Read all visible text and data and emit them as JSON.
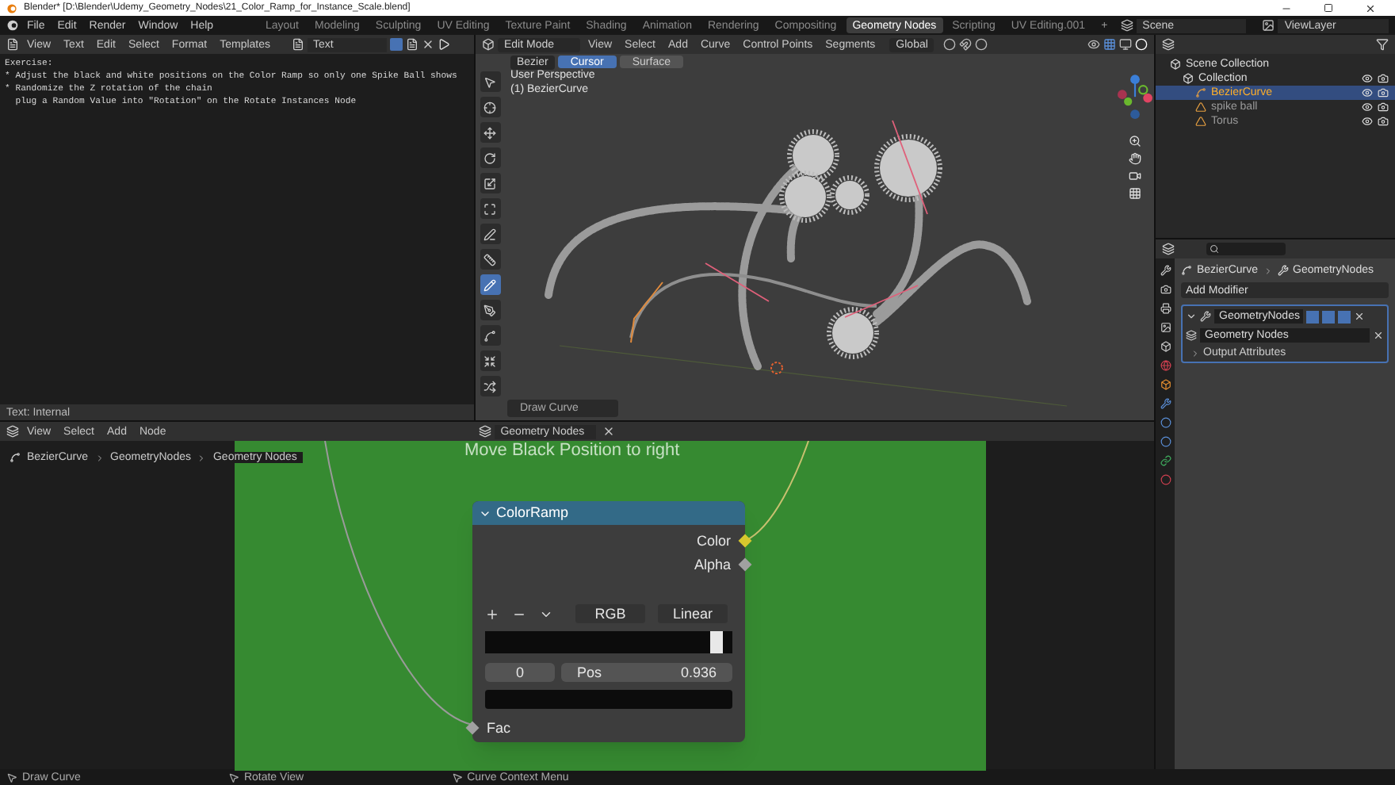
{
  "window": {
    "title": "Blender* [D:\\Blender\\Udemy_Geometry_Nodes\\21_Color_Ramp_for_Instance_Scale.blend]"
  },
  "menu": [
    "File",
    "Edit",
    "Render",
    "Window",
    "Help"
  ],
  "workspaces": [
    {
      "label": "Layout",
      "selected": false
    },
    {
      "label": "Modeling",
      "selected": false
    },
    {
      "label": "Sculpting",
      "selected": false
    },
    {
      "label": "UV Editing",
      "selected": false
    },
    {
      "label": "Texture Paint",
      "selected": false
    },
    {
      "label": "Shading",
      "selected": false
    },
    {
      "label": "Animation",
      "selected": false
    },
    {
      "label": "Rendering",
      "selected": false
    },
    {
      "label": "Compositing",
      "selected": false
    },
    {
      "label": "Geometry Nodes",
      "selected": true
    },
    {
      "label": "Scripting",
      "selected": false
    },
    {
      "label": "UV Editing.001",
      "selected": false
    }
  ],
  "add_workspace": "+",
  "scene": "Scene",
  "view_layer": "ViewLayer",
  "text_editor": {
    "menu": [
      "View",
      "Text",
      "Edit",
      "Select",
      "Format",
      "Templates"
    ],
    "text_name": "Text",
    "lines": [
      "Exercise:",
      "* Adjust the black and white positions on the Color Ramp so only one Spike Ball shows",
      "* Randomize the Z rotation of the chain",
      "  plug a Random Value into \"Rotation\" on the Rotate Instances Node"
    ],
    "footer": "Text: Internal"
  },
  "viewport": {
    "mode": "Edit Mode",
    "menu": [
      "View",
      "Select",
      "Add",
      "Curve",
      "Control Points",
      "Segments"
    ],
    "orientation": "Global",
    "curve_type": "Bezier",
    "draw_modes": [
      {
        "label": "Cursor",
        "selected": true
      },
      {
        "label": "Surface",
        "selected": false
      }
    ],
    "perspective": "User Perspective",
    "object": "(1) BezierCurve",
    "tools": [
      {
        "selected": false
      },
      {
        "selected": false
      },
      {
        "selected": false
      },
      {
        "selected": false
      },
      {
        "selected": false
      },
      {
        "selected": false
      },
      {
        "selected": false
      },
      {
        "selected": false
      },
      {
        "selected": true
      },
      {
        "selected": false
      },
      {
        "selected": false
      },
      {
        "selected": false
      },
      {
        "selected": false
      }
    ],
    "last_operator": "Draw Curve"
  },
  "outliner": {
    "tree": [
      {
        "label": "Scene Collection",
        "kind": "scene",
        "selected": false,
        "children": [
          {
            "label": "Collection",
            "kind": "collection",
            "selected": false,
            "children": [
              {
                "label": "BezierCurve",
                "kind": "curve",
                "selected": true
              },
              {
                "label": "spike ball",
                "kind": "mesh",
                "selected": false
              },
              {
                "label": "Torus",
                "kind": "mesh",
                "selected": false
              }
            ]
          }
        ]
      }
    ]
  },
  "properties": {
    "breadcrumb": [
      "BezierCurve",
      "GeometryNodes"
    ],
    "add_modifier": "Add Modifier",
    "modifier": {
      "name": "GeometryNodes",
      "expanded": true,
      "node_group": "Geometry Nodes",
      "sections": [
        "Output Attributes"
      ]
    }
  },
  "node_editor": {
    "menu": [
      "View",
      "Select",
      "Add",
      "Node"
    ],
    "node_tree": "Geometry Nodes",
    "breadcrumb": [
      "BezierCurve",
      "GeometryNodes",
      "Geometry Nodes"
    ],
    "frame_label": "Move Black Position to right",
    "node": {
      "title": "ColorRamp",
      "outputs": [
        {
          "label": "Color",
          "color": "#d6c72e"
        },
        {
          "label": "Alpha",
          "color": "#a1a1a1"
        }
      ],
      "color_mode": "RGB",
      "interpolation": "Linear",
      "ramp": {
        "level": 0.936
      },
      "stop_index": "0",
      "pos_label": "Pos",
      "pos_value": "0.936",
      "input": "Fac"
    }
  },
  "status_bar": [
    "Draw Curve",
    "Rotate View",
    "Curve Context Menu"
  ]
}
